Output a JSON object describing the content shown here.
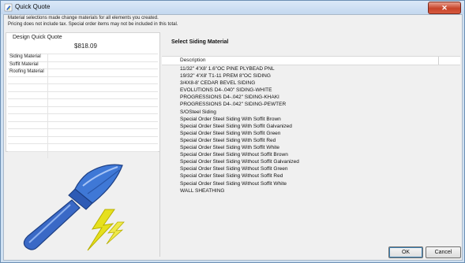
{
  "window": {
    "title": "Quick Quote",
    "close_symbol": "✕"
  },
  "info": {
    "line1": "Material selections made change materials for all elements you created.",
    "line2": "Pricing does not include tax. Special order items may not be included in this total."
  },
  "design": {
    "label": "Design Quick Quote",
    "price": "$818.09",
    "rows": [
      {
        "label": "Siding Material",
        "value": ""
      },
      {
        "label": "Soffit Material",
        "value": ""
      },
      {
        "label": "Roofing Material",
        "value": ""
      }
    ]
  },
  "siding": {
    "title": "Select Siding Material",
    "column": "Description",
    "items": [
      "11/32\" 4'X8' 1.6\"OC PINE PLYBEAD PNL",
      "19/32\" 4'X8' T1-11 PREM 8\"OC SIDING",
      "3/4X8-8' CEDAR BEVEL SIDING",
      "EVOLUTIONS D4-.040\" SIDING-WHITE",
      "PROGRESSIONS D4-.042\" SIDING-KHAKI",
      "PROGRESSIONS D4-.042\" SIDING-PEWTER",
      "S/OSteel Siding",
      "Special Order Steel Siding With Soffit Brown",
      "Special Order Steel Siding With Soffit Galvanized",
      "Special Order Steel Siding With Soffit Green",
      "Special Order Steel Siding With Soffit Red",
      "Special Order Steel Siding With Soffit White",
      "Special Order Steel Siding Without Soffit Brown",
      "Special Order Steel Siding Without Soffit Galvanized",
      "Special Order Steel Siding Without Soffit Green",
      "Special Order Steel Siding Without Soffit Red",
      "Special Order Steel Siding Without Soffit White",
      "WALL SHEATHING"
    ]
  },
  "buttons": {
    "ok": "OK",
    "cancel": "Cancel"
  },
  "icons": {
    "app": "paintbrush-icon",
    "illustration": "paintbrush-lightning-icon"
  },
  "colors": {
    "brush_blue": "#3b6fc7",
    "lightning_yellow": "#e6e01e"
  }
}
